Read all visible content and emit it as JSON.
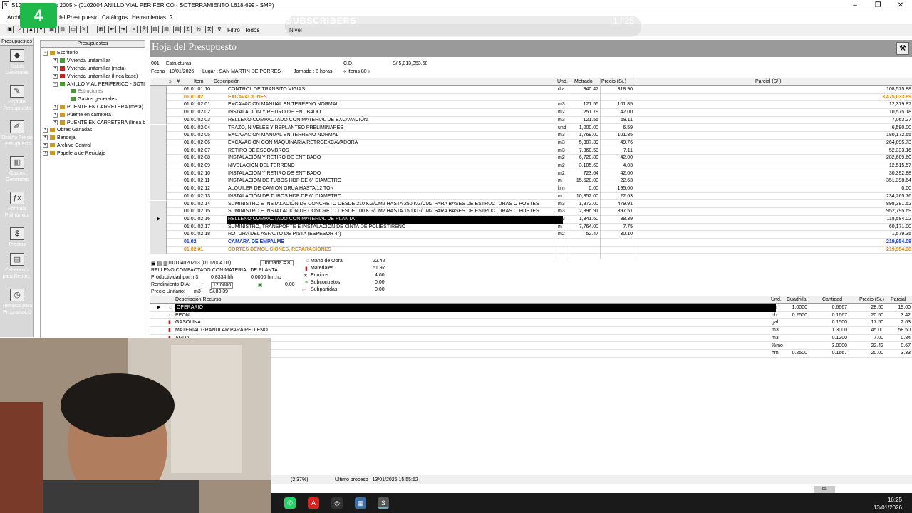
{
  "window": {
    "title": "S10 Presupuestos 2005 » (0102004 ANILLO VIAL PERIFERICO - SOTERRAMIENTO L618-699 - SMP)",
    "minimize": "–",
    "restore": "❐",
    "close": "✕"
  },
  "menu": [
    "Archivo",
    "Hoja del Presupuesto",
    "Catálogos",
    "Herramientas",
    "?"
  ],
  "toolbar": {
    "filter_label": "Filtro",
    "filter_value": "Todos"
  },
  "overlay": {
    "subscribers": "SUBSCRIBERS",
    "counter": "1 / 25",
    "nivel": "Nivel",
    "logo": "4"
  },
  "leftbar": {
    "header": "Presupuestos",
    "items": [
      {
        "label": "Datos Generales",
        "icon": "◆"
      },
      {
        "label": "Hoja del Presupuesto",
        "icon": "✎"
      },
      {
        "label": "Diseño Pie de Presupuesto",
        "icon": "✐"
      },
      {
        "label": "Gastos Generales",
        "icon": "▥"
      },
      {
        "label": "Fórmula Polinómica",
        "icon": "ƒx"
      },
      {
        "label": "Precios",
        "icon": "$"
      },
      {
        "label": "Cabeceras para Repor...",
        "icon": "▤"
      },
      {
        "label": "Tiempos para Programació",
        "icon": "◷"
      }
    ]
  },
  "tree": {
    "header": "Presupuestos",
    "nodes": [
      {
        "label": "Escritorio"
      },
      {
        "label": "Vivienda unifamiliar"
      },
      {
        "label": "Vivienda unifamiliar (meta)"
      },
      {
        "label": "Vivienda unifamiliar (línea base)"
      },
      {
        "label": "ANILLO VIAL PERIFERICO - SOTI"
      },
      {
        "label": "Estructuras"
      },
      {
        "label": "Gastos generales"
      },
      {
        "label": "PUENTE EN CARRETERA (meta)"
      },
      {
        "label": "Puente en carretera"
      },
      {
        "label": "PUENTE EN CARRETERA (línea b"
      },
      {
        "label": "Obras Ganadas"
      },
      {
        "label": "Bandeja"
      },
      {
        "label": "Archivo Central"
      },
      {
        "label": "Papelera de Reciclaje"
      }
    ]
  },
  "sheet": {
    "title": "Hoja del Presupuesto",
    "code": "001",
    "name": "Estructuras",
    "cd": "C.D.",
    "total": "S/.5,013,053.68",
    "fecha": "Fecha : 10/01/2026",
    "lugar": "Lugar : SAN MARTIN DE PORRES",
    "jornada": "Jornada : 8 horas",
    "items_count": "« Items 80 »"
  },
  "grid": {
    "headers": {
      "item": "Item",
      "desc": "Descripción",
      "und": "Und.",
      "met": "Metrado",
      "pre": "Precio (S/.)",
      "par": "Parcial (S/.)"
    },
    "rows": [
      {
        "item": "01.01.01.10",
        "desc": "CONTROL DE TRANSITO VIGIAS",
        "und": "dia",
        "met": "340.47",
        "pre": "318.90",
        "par": "108,575.88",
        "type": "item"
      },
      {
        "item": "01.01.02",
        "desc": "EXCAVACIONES",
        "und": "",
        "met": "",
        "pre": "",
        "par": "3,475,033.89",
        "type": "title"
      },
      {
        "item": "01.01.02.01",
        "desc": "EXCAVACION MANUAL EN TERRENO NORMAL",
        "und": "m3",
        "met": "121.55",
        "pre": "101.85",
        "par": "12,379.87",
        "type": "item"
      },
      {
        "item": "01.01.02.02",
        "desc": "INSTALACIÓN Y RETIRO DE ENTIBADO",
        "und": "m2",
        "met": "251.79",
        "pre": "42.00",
        "par": "10,575.18",
        "type": "item"
      },
      {
        "item": "01.01.02.03",
        "desc": "RELLENO COMPACTADO CON MATERIAL DE EXCAVACIÓN",
        "und": "m3",
        "met": "121.55",
        "pre": "58.11",
        "par": "7,063.27",
        "type": "item"
      },
      {
        "item": "01.01.02.04",
        "desc": "TRAZO, NIVELES Y REPLANTEO PRELIMINARES",
        "und": "und",
        "met": "1,000.00",
        "pre": "6.59",
        "par": "6,590.00",
        "type": "item"
      },
      {
        "item": "01.01.02.05",
        "desc": "EXCAVACION MANUAL EN TERRENO NORMAL",
        "und": "m3",
        "met": "1,769.00",
        "pre": "101.85",
        "par": "180,172.65",
        "type": "item"
      },
      {
        "item": "01.01.02.06",
        "desc": "EXCAVACION CON MAQUINARIA RETROEXCAVADORA",
        "und": "m3",
        "met": "5,307.39",
        "pre": "49.76",
        "par": "264,095.73",
        "type": "item"
      },
      {
        "item": "01.01.02.07",
        "desc": "RETIRO DE ESCOMBROS",
        "und": "m3",
        "met": "7,360.50",
        "pre": "7.11",
        "par": "52,333.16",
        "type": "item"
      },
      {
        "item": "01.01.02.08",
        "desc": "INSTALACIÓN Y RETIRO DE ENTIBADO",
        "und": "m2",
        "met": "6,728.80",
        "pre": "42.00",
        "par": "282,609.60",
        "type": "item"
      },
      {
        "item": "01.01.02.09",
        "desc": "NIVELACION DEL TERRENO",
        "und": "m2",
        "met": "3,105.60",
        "pre": "4.03",
        "par": "12,515.57",
        "type": "item"
      },
      {
        "item": "01.01.02.10",
        "desc": "INSTALACIÓN Y RETIRO DE ENTIBADO",
        "und": "m2",
        "met": "723.64",
        "pre": "42.00",
        "par": "30,392.88",
        "type": "item"
      },
      {
        "item": "01.01.02.11",
        "desc": "INSTALACIÓN DE TUBOS HDP DE 6\" DIAMETRO",
        "und": "m",
        "met": "15,528.00",
        "pre": "22.63",
        "par": "351,398.64",
        "type": "item"
      },
      {
        "item": "01.01.02.12",
        "desc": "ALQUILER DE CAMION GRUA HASTA 12 TON",
        "und": "hm",
        "met": "0.00",
        "pre": "195.00",
        "par": "0.00",
        "type": "item"
      },
      {
        "item": "01.01.02.13",
        "desc": "INSTALACIÓN DE TUBOS HDP DE 6\" DIAMETRO",
        "und": "m",
        "met": "10,352.00",
        "pre": "22.63",
        "par": "234,265.76",
        "type": "item"
      },
      {
        "item": "01.01.02.14",
        "desc": "SUMINISTRO E INSTALACIÓN DE CONCRETO DESDE 210 KG/CM2 HASTA 250 KG/CM2 PARA BASES DE ESTRUCTURAS O POSTES",
        "und": "m3",
        "met": "1,872.00",
        "pre": "479.91",
        "par": "898,391.52",
        "type": "item"
      },
      {
        "item": "01.01.02.15",
        "desc": "SUMINISTRO E INSTALACIÓN DE CONCRETO DESDE 100 KG/CM2 HASTA 150 KG/CM2 PARA BASES DE ESTRUCTURAS O POSTES",
        "und": "m3",
        "met": "2,396.91",
        "pre": "397.51",
        "par": "952,795.69",
        "type": "item"
      },
      {
        "item": "01.01.02.16",
        "desc": "RELLENO COMPACTADO CON MATERIAL DE PLANTA",
        "und": "m3",
        "met": "1,341.60",
        "pre": "88.39",
        "par": "118,584.02",
        "type": "sel"
      },
      {
        "item": "01.01.02.17",
        "desc": "SUMINISTRO, TRANSPORTE E INSTALACIÓN DE CINTA DE POLIESTIRENO",
        "und": "m",
        "met": "7,764.00",
        "pre": "7.75",
        "par": "60,171.00",
        "type": "item"
      },
      {
        "item": "01.01.02.18",
        "desc": "ROTURA DEL ASFALTO DE PISTA (ESPESOR 4\")",
        "und": "m2",
        "met": "52.47",
        "pre": "30.10",
        "par": "1,579.35",
        "type": "item"
      },
      {
        "item": "01.02",
        "desc": "CAMARA DE EMPALME",
        "und": "",
        "met": "",
        "pre": "",
        "par": "219,954.08",
        "type": "title2"
      },
      {
        "item": "01.02.01",
        "desc": "CORTES DEMOLICIONES, REPARACIONES",
        "und": "",
        "met": "",
        "pre": "",
        "par": "219,954.08",
        "type": "title"
      }
    ]
  },
  "detail": {
    "code": "010104020213 (0102004 01)",
    "jornada": "Jornada = 8",
    "desc": "RELLENO COMPACTADO CON MATERIAL DE PLANTA",
    "prod_label": "Productividad por m3:",
    "prod_hh": "0.8334 hh",
    "prod_hmhp": "0.0000 hm.hp",
    "rend_label": "Rendimiento DIA:",
    "rend_val": "12.0000",
    "rend_pct": "0.00",
    "pu_label": "Precio Unitario:",
    "pu_und": "m3",
    "pu_val": "S/.88.39",
    "costs": [
      {
        "label": "Mano de Obra",
        "value": "22.42"
      },
      {
        "label": "Materiales",
        "value": "61.97"
      },
      {
        "label": "Equipos",
        "value": "4.00"
      },
      {
        "label": "Subcontratos",
        "value": "0.00"
      },
      {
        "label": "Subpartidas",
        "value": "0.00"
      }
    ]
  },
  "resources": {
    "headers": {
      "desc": "Descripción Recurso",
      "und": "Und.",
      "cua": "Cuadrilla",
      "can": "Cantidad",
      "pre": "Precio (S/.)",
      "par": "Parcial"
    },
    "rows": [
      {
        "desc": "OPERARIO",
        "und": "hh",
        "cua": "1.0000",
        "can": "0.6667",
        "pre": "28.50",
        "par": "19.00"
      },
      {
        "desc": "PEON",
        "und": "hh",
        "cua": "0.2500",
        "can": "0.1667",
        "pre": "20.50",
        "par": "3.42"
      },
      {
        "desc": "GASOLINA",
        "und": "gal",
        "cua": "",
        "can": "0.1500",
        "pre": "17.50",
        "par": "2.63"
      },
      {
        "desc": "MATERIAL GRANULAR PARA RELLENO",
        "und": "m3",
        "cua": "",
        "can": "1.3000",
        "pre": "45.00",
        "par": "58.50"
      },
      {
        "desc": "AGUA",
        "und": "m3",
        "cua": "",
        "can": "0.1200",
        "pre": "7.00",
        "par": "0.84"
      },
      {
        "desc": "",
        "und": "%mo",
        "cua": "",
        "can": "3.0000",
        "pre": "22.42",
        "par": "0.67"
      },
      {
        "desc": "NCHA 7 HP",
        "und": "hm",
        "cua": "0.2500",
        "can": "0.1667",
        "pre": "20.00",
        "par": "3.33"
      }
    ]
  },
  "status": {
    "pct": "(2.37%)",
    "last": "Ultimo proceso : 13/01/2026 15:55:52"
  },
  "taskbar": {
    "time": "16:25",
    "date": "13/01/2026",
    "tray": "sa"
  }
}
